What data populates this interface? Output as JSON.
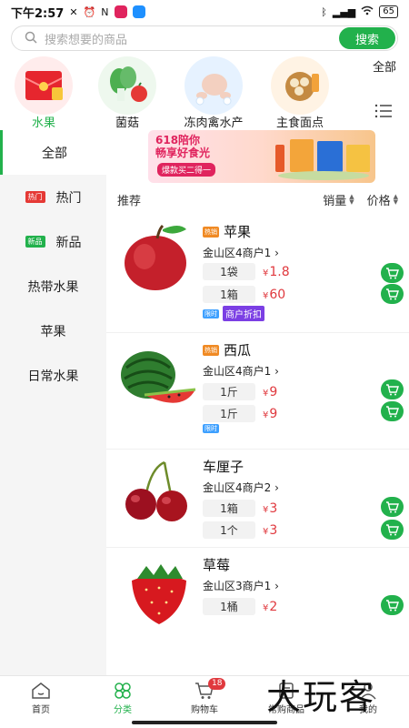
{
  "status_bar": {
    "time": "下午2:57",
    "battery": "65"
  },
  "search": {
    "placeholder": "搜索想要的商品",
    "button_label": "搜索"
  },
  "categories": [
    {
      "label": "水果",
      "icon": "red-envelope-icon",
      "active": true
    },
    {
      "label": "菌菇",
      "icon": "vegetables-icon"
    },
    {
      "label": "冻肉禽水产",
      "icon": "chicken-icon"
    },
    {
      "label": "主食面点",
      "icon": "dumplings-icon"
    }
  ],
  "all_categories_label": "全部",
  "sidebar": {
    "items": [
      {
        "label": "全部",
        "active": true
      },
      {
        "label": "热门",
        "badge": "热门"
      },
      {
        "label": "新品",
        "badge": "新品"
      },
      {
        "label": "热带水果"
      },
      {
        "label": "苹果"
      },
      {
        "label": "日常水果"
      }
    ]
  },
  "banner": {
    "title_line1": "618陪你",
    "title_line2": "畅享好食光",
    "subtitle": "爆款买二得一"
  },
  "filter": {
    "recommend": "推荐",
    "sales": "销量",
    "price": "价格"
  },
  "products": [
    {
      "name": "苹果",
      "hot_tag": "热销",
      "merchant": "金山区4商户1",
      "skus": [
        {
          "unit": "1袋",
          "price": "1.8"
        },
        {
          "unit": "1箱",
          "price": "60"
        }
      ],
      "tags": {
        "limit": "限时",
        "discount": "商户折扣"
      }
    },
    {
      "name": "西瓜",
      "hot_tag": "热销",
      "merchant": "金山区4商户1",
      "skus": [
        {
          "unit": "1斤",
          "price": "9"
        },
        {
          "unit": "1斤",
          "price": "9"
        }
      ],
      "tags": {
        "limit": "限时"
      }
    },
    {
      "name": "车厘子",
      "merchant": "金山区4商户2",
      "skus": [
        {
          "unit": "1箱",
          "price": "3"
        },
        {
          "unit": "1个",
          "price": "3"
        }
      ]
    },
    {
      "name": "草莓",
      "merchant": "金山区3商户1",
      "skus": [
        {
          "unit": "1桶",
          "price": "2"
        }
      ]
    }
  ],
  "currency_symbol": "¥",
  "bottom_nav": [
    {
      "label": "首页",
      "icon": "home-icon"
    },
    {
      "label": "分类",
      "icon": "category-icon",
      "active": true
    },
    {
      "label": "购物车",
      "icon": "cart-icon",
      "badge": "18"
    },
    {
      "label": "常购商品",
      "icon": "frequent-icon"
    },
    {
      "label": "我的",
      "icon": "profile-icon"
    }
  ],
  "watermark": "大玩客",
  "colors": {
    "accent": "#22b14c",
    "price": "#e0393e",
    "discount_tag": "#7b3fe4",
    "limit_tag": "#3ea0ff"
  }
}
